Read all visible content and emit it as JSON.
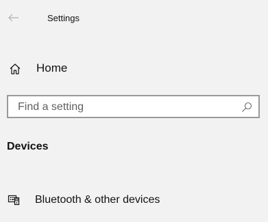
{
  "window": {
    "title": "Settings"
  },
  "icons": {
    "back": "arrow-left-icon",
    "home": "home-icon",
    "search": "search-icon",
    "bluetooth": "devices-keyboard-icon"
  },
  "sidebar": {
    "home_label": "Home",
    "search": {
      "placeholder": "Find a setting"
    },
    "section_heading": "Devices",
    "items": [
      {
        "label": "Bluetooth & other devices"
      }
    ]
  },
  "colors": {
    "background": "#f2f2f2",
    "search_border": "#999999",
    "placeholder": "#5f5f5f",
    "text": "#111111"
  }
}
